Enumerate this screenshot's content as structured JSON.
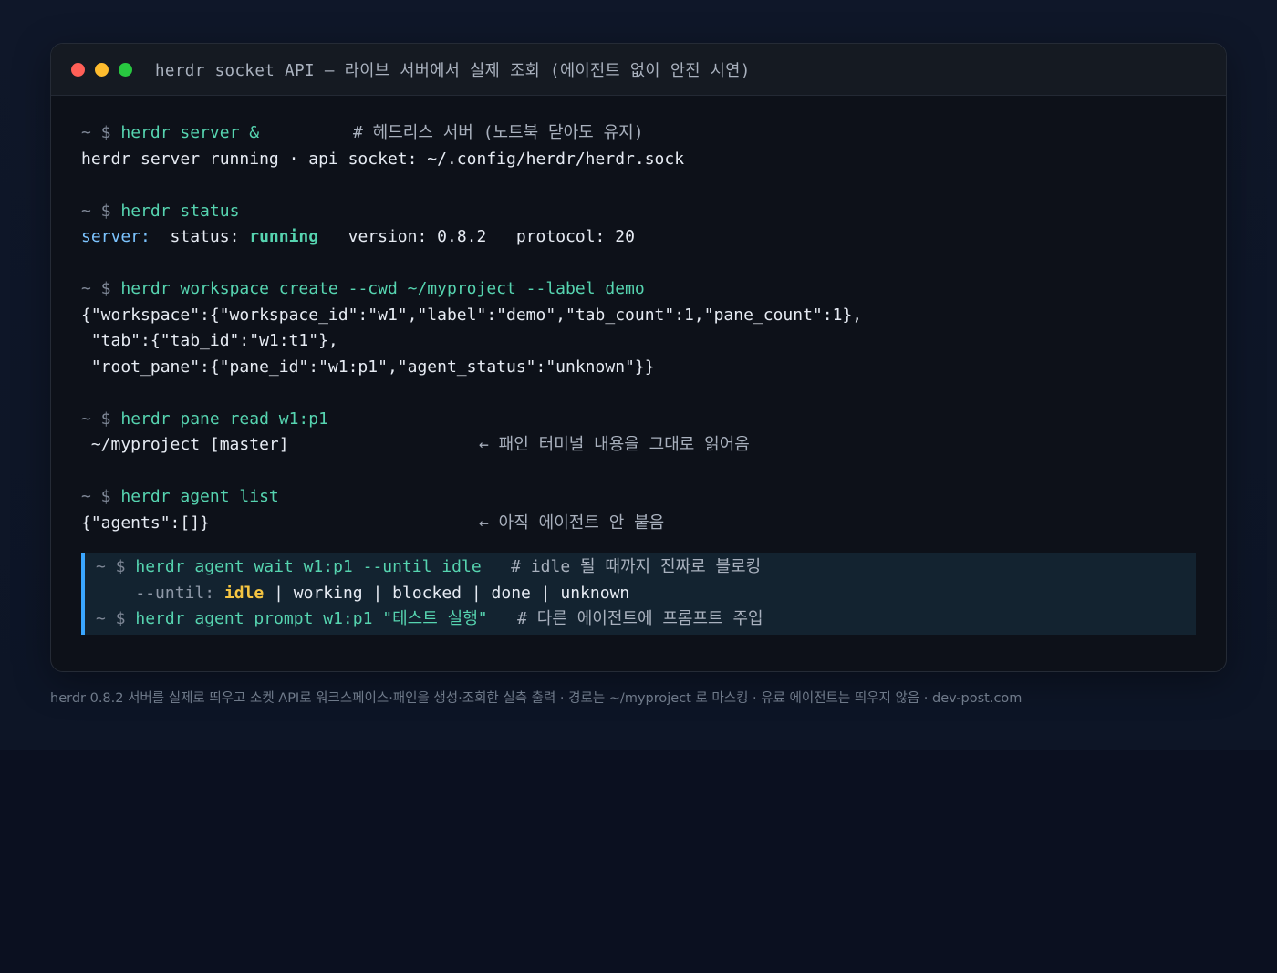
{
  "window": {
    "title": "herdr socket API — 라이브 서버에서 실제 조회 (에이전트 없이 안전 시연)"
  },
  "prompt": "~ $",
  "blocks": {
    "server": {
      "cmd": "herdr server &",
      "comment": "# 헤드리스 서버 (노트북 닫아도 유지)",
      "out": "herdr server running · api socket: ~/.config/herdr/herdr.sock"
    },
    "status": {
      "cmd": "herdr status",
      "label": "server:",
      "status_key": "status:",
      "status_value": "running",
      "version": "version: 0.8.2",
      "protocol": "protocol: 20"
    },
    "workspace": {
      "cmd": "herdr workspace create --cwd ~/myproject --label demo",
      "out1": "{\"workspace\":{\"workspace_id\":\"w1\",\"label\":\"demo\",\"tab_count\":1,\"pane_count\":1},",
      "out2": " \"tab\":{\"tab_id\":\"w1:t1\"},",
      "out3": " \"root_pane\":{\"pane_id\":\"w1:p1\",\"agent_status\":\"unknown\"}}"
    },
    "pane": {
      "cmd": "herdr pane read w1:p1",
      "out": " ~/myproject [master]",
      "note": "← 패인 터미널 내용을 그대로 읽어옴"
    },
    "agent_list": {
      "cmd": "herdr agent list",
      "out": "{\"agents\":[]}",
      "note": "← 아직 에이전트 안 붙음"
    },
    "highlight": {
      "wait_cmd": "herdr agent wait w1:p1 --until idle",
      "wait_comment": "# idle 될 때까지 진짜로 블로킹",
      "until_label": "--until:",
      "until_idle": "idle",
      "until_rest": "| working | blocked | done | unknown",
      "prompt_cmd": "herdr agent prompt w1:p1 \"테스트 실행\"",
      "prompt_comment": "# 다른 에이전트에 프롬프트 주입"
    }
  },
  "caption": "herdr 0.8.2 서버를 실제로 띄우고 소켓 API로 워크스페이스·패인을 생성·조회한 실측 출력 · 경로는 ~/myproject 로 마스킹 · 유료 에이전트는 띄우지 않음 · dev-post.com",
  "colors": {
    "accent": "#3aa6ff",
    "command": "#56d4b0",
    "key": "#7cc4ff",
    "idle": "#f5c542"
  }
}
